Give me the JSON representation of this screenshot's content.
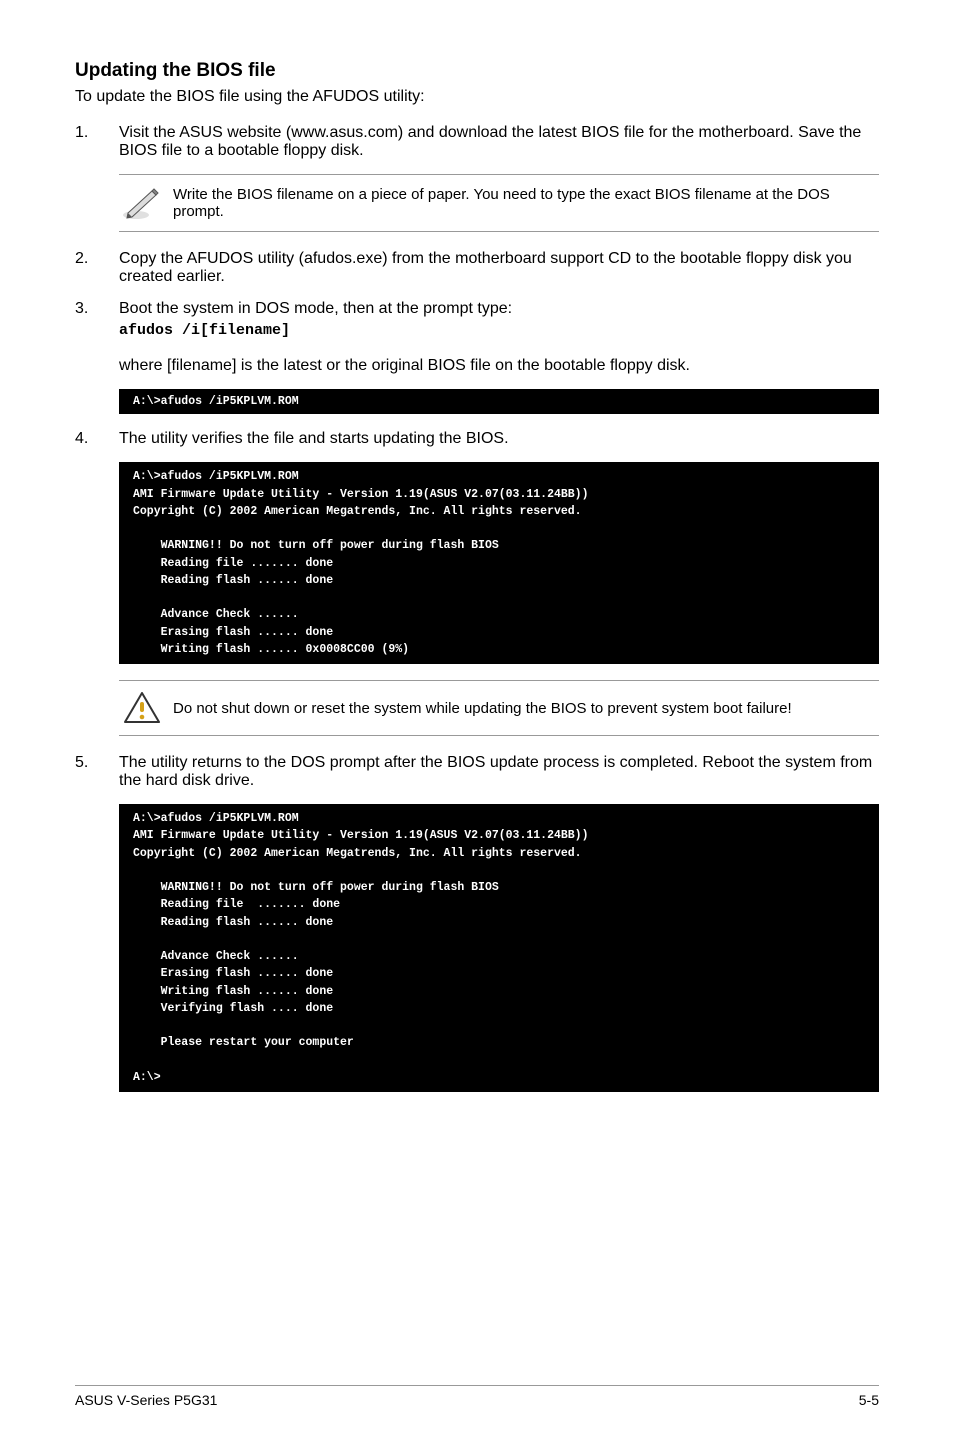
{
  "heading": "Updating the BIOS file",
  "intro": "To update the BIOS file using the AFUDOS utility:",
  "steps": {
    "s1_num": "1.",
    "s1": "Visit the ASUS website (www.asus.com) and download the latest BIOS file for the motherboard. Save the BIOS file to a bootable floppy disk.",
    "note1": "Write the BIOS filename on a piece of paper. You need to type the exact BIOS filename at the DOS prompt.",
    "s2_num": "2.",
    "s2": "Copy the AFUDOS utility (afudos.exe) from the motherboard support CD to the bootable floppy disk you created earlier.",
    "s3_num": "3.",
    "s3a": "Boot the system in DOS mode, then at the prompt type:",
    "s3b": "afudos /i[filename]",
    "s3c": "where [filename] is the latest or the original BIOS file on the bootable floppy disk.",
    "term1": "A:\\>afudos /iP5KPLVM.ROM",
    "s4_num": "4.",
    "s4": "The utility verifies the file and starts updating the BIOS.",
    "term2": "A:\\>afudos /iP5KPLVM.ROM\nAMI Firmware Update Utility - Version 1.19(ASUS V2.07(03.11.24BB))\nCopyright (C) 2002 American Megatrends, Inc. All rights reserved.\n\n    WARNING!! Do not turn off power during flash BIOS\n    Reading file ....... done\n    Reading flash ...... done\n\n    Advance Check ......\n    Erasing flash ...... done\n    Writing flash ...... 0x0008CC00 (9%)",
    "note2": "Do not shut down or reset the system while updating the BIOS to prevent system boot failure!",
    "s5_num": "5.",
    "s5": "The utility returns to the DOS prompt after the BIOS update process is completed. Reboot the system from the hard disk drive.",
    "term3": "A:\\>afudos /iP5KPLVM.ROM\nAMI Firmware Update Utility - Version 1.19(ASUS V2.07(03.11.24BB))\nCopyright (C) 2002 American Megatrends, Inc. All rights reserved.\n\n    WARNING!! Do not turn off power during flash BIOS\n    Reading file  ....... done\n    Reading flash ...... done\n\n    Advance Check ......\n    Erasing flash ...... done\n    Writing flash ...... done\n    Verifying flash .... done\n\n    Please restart your computer\n\nA:\\>"
  },
  "footer": {
    "left": "ASUS  V-Series P5G31",
    "right": "5-5"
  }
}
